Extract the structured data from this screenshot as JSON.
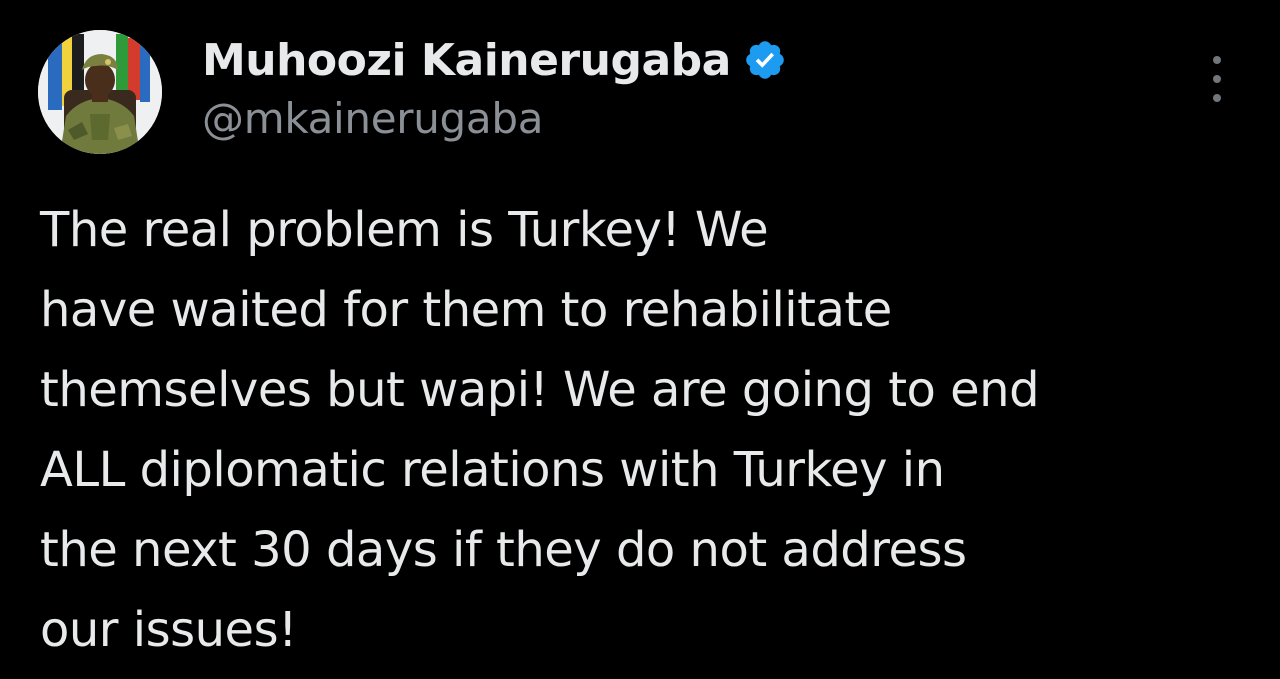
{
  "author": {
    "display_name": "Muhoozi Kainerugaba",
    "handle": "@mkainerugaba",
    "verified": true,
    "avatar_icon": "profile-photo"
  },
  "icons": {
    "verified": "verified-badge-icon",
    "more": "more-options-icon"
  },
  "tweet": {
    "lines": [
      "The real problem is Turkey! We",
      "have waited for them to rehabilitate",
      "themselves but wapi! We are going to end",
      "ALL diplomatic relations with Turkey in",
      "the next 30 days if they do not address",
      "our issues!"
    ]
  },
  "colors": {
    "background": "#000000",
    "primary_text": "#e7e9ea",
    "secondary_text": "#8b9096",
    "verified_blue": "#1d9bf0"
  }
}
